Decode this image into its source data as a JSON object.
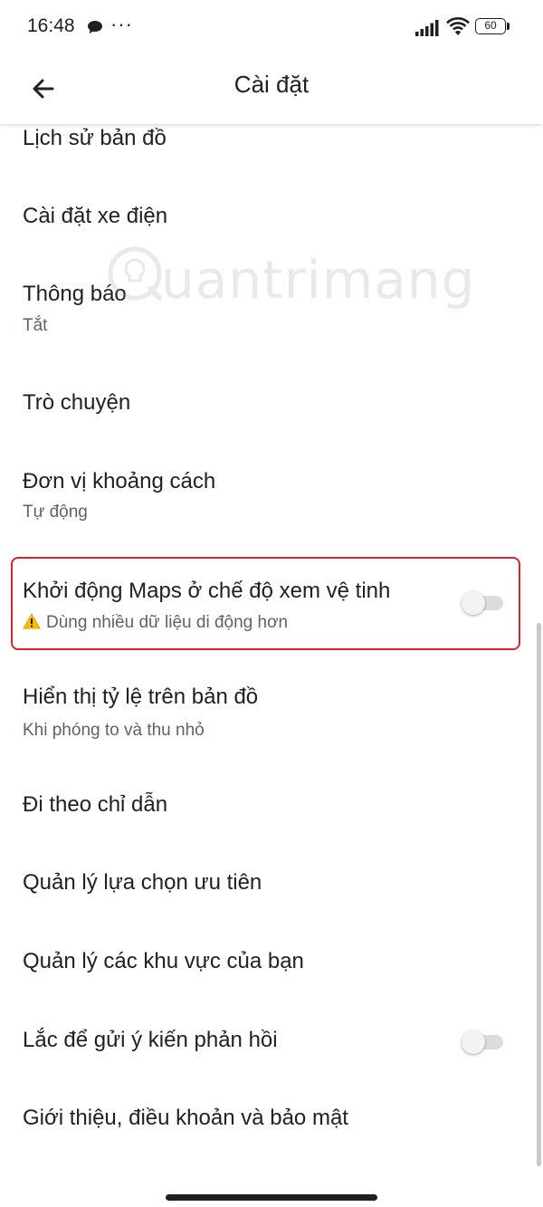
{
  "status_bar": {
    "time": "16:48",
    "more_indicator": "···",
    "battery": "60",
    "icons": [
      "chat-bubble-icon",
      "signal-icon",
      "wifi-icon",
      "battery-icon"
    ]
  },
  "app_bar": {
    "title": "Cài đặt",
    "back_icon": "arrow-back-icon"
  },
  "watermark": {
    "text": "uantrimang",
    "logo_icon": "lightbulb-q-icon"
  },
  "settings": [
    {
      "id": "map-history",
      "title": "Lịch sử bản đồ"
    },
    {
      "id": "ev-settings",
      "title": "Cài đặt xe điện"
    },
    {
      "id": "notifications",
      "title": "Thông báo",
      "subtitle": "Tắt"
    },
    {
      "id": "chat",
      "title": "Trò chuyện"
    },
    {
      "id": "distance-units",
      "title": "Đơn vị khoảng cách",
      "subtitle": "Tự động"
    },
    {
      "id": "satellite-start",
      "title": "Khởi động Maps ở chế độ xem vệ tinh",
      "subtitle": "Dùng nhiều dữ liệu di động hơn",
      "subtitle_icon": "warning-icon",
      "toggle": false,
      "highlighted": true
    },
    {
      "id": "show-scale",
      "title": "Hiển thị tỷ lệ trên bản đồ",
      "subtitle": "Khi phóng to và thu nhỏ"
    },
    {
      "id": "follow-directions",
      "title": "Đi theo chỉ dẫn"
    },
    {
      "id": "manage-preferences",
      "title": "Quản lý lựa chọn ưu tiên"
    },
    {
      "id": "manage-areas",
      "title": "Quản lý các khu vực của bạn"
    },
    {
      "id": "shake-feedback",
      "title": "Lắc để gửi ý kiến phản hồi",
      "toggle": false
    },
    {
      "id": "about",
      "title": "Giới thiệu, điều khoản và bảo mật"
    }
  ],
  "colors": {
    "highlight_border": "#e02030",
    "primary_text": "#202124",
    "secondary_text": "#5f6368",
    "toggle_off_track": "#dadce0",
    "warning": "#fbbc04"
  }
}
